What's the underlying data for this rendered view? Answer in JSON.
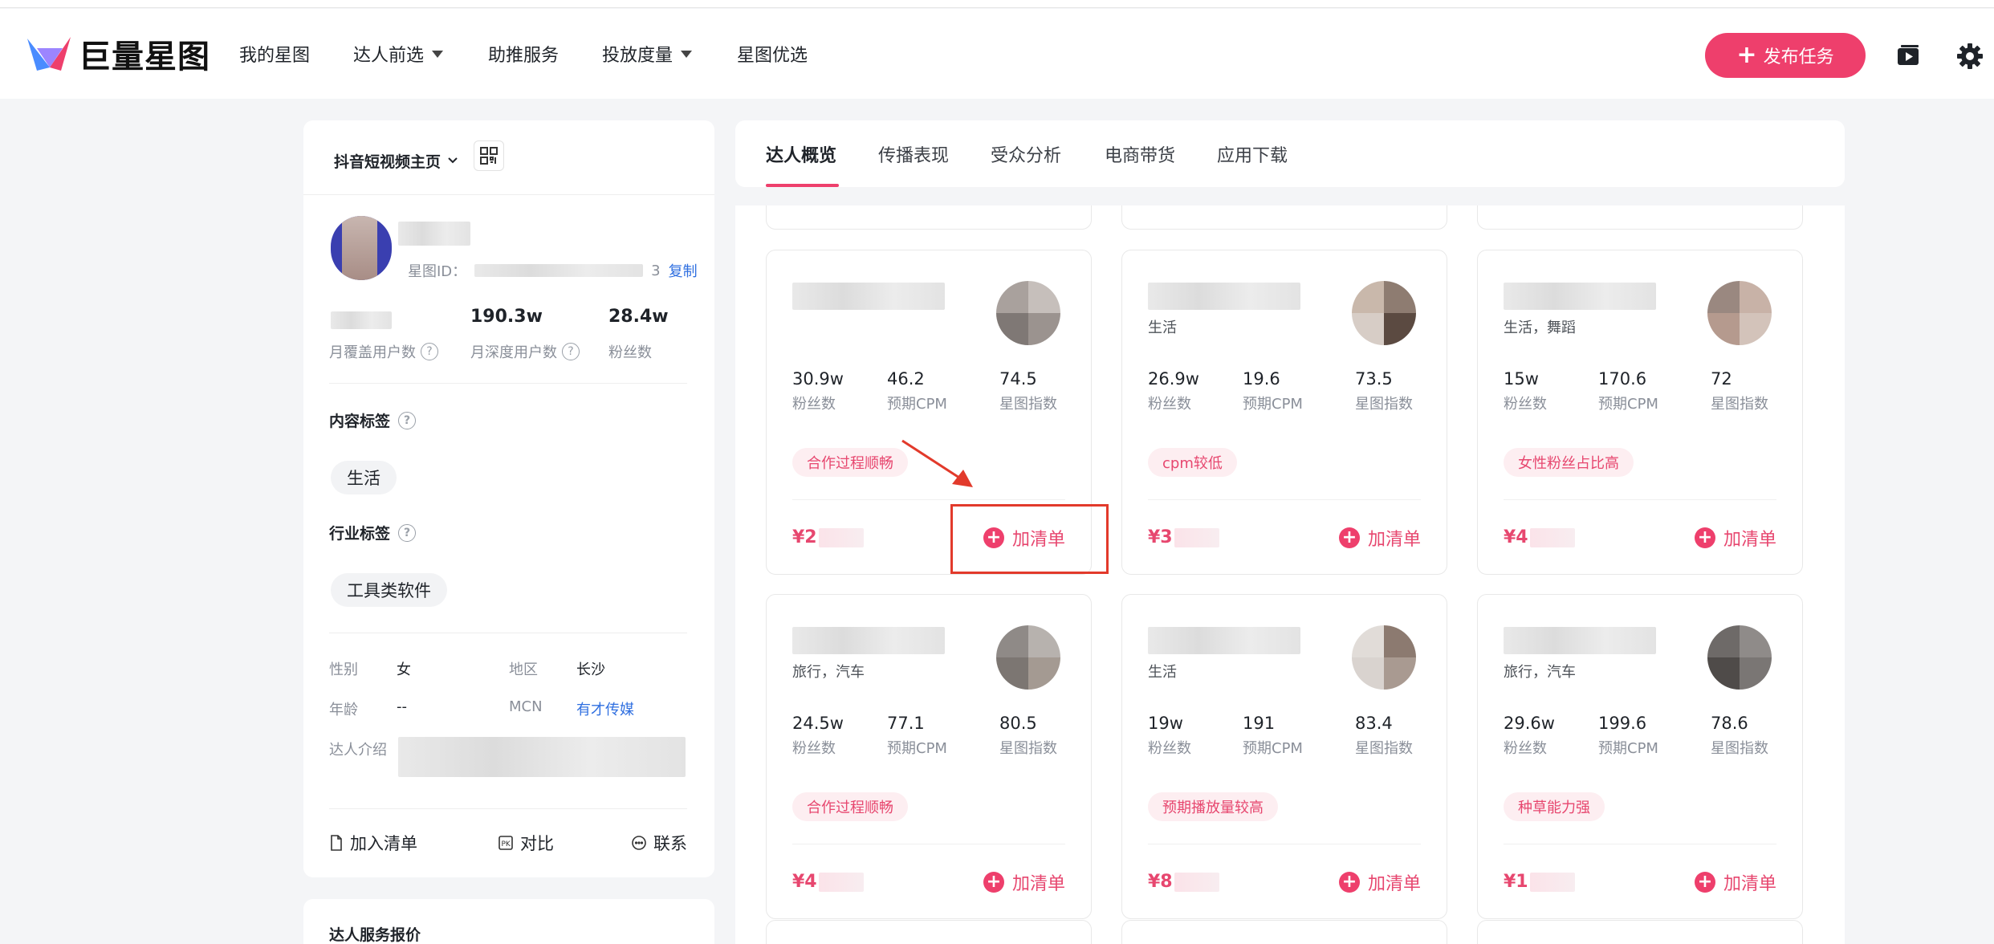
{
  "nav": {
    "logo_text": "巨量星图",
    "items": [
      "我的星图",
      "达人前选",
      "助推服务",
      "投放度量",
      "星图优选"
    ],
    "publish_label": "发布任务",
    "icons": [
      "video-icon",
      "gear-icon"
    ]
  },
  "profile": {
    "platform": "抖音短视频主页",
    "id_label": "星图ID：",
    "id_tail": "3",
    "copy_label": "复制",
    "stats": [
      {
        "value": "",
        "label": "月覆盖用户数"
      },
      {
        "value": "190.3w",
        "label": "月深度用户数"
      },
      {
        "value": "28.4w",
        "label": "粉丝数"
      }
    ],
    "content_tag_title": "内容标签",
    "content_tag": "生活",
    "industry_tag_title": "行业标签",
    "industry_tag": "工具类软件",
    "gender_label": "性别",
    "gender": "女",
    "region_label": "地区",
    "region": "长沙",
    "age_label": "年龄",
    "age": "--",
    "mcn_label": "MCN",
    "mcn": "有才传媒",
    "intro_label": "达人介绍",
    "actions": [
      "加入清单",
      "对比",
      "联系"
    ],
    "quote_title": "达人服务报价"
  },
  "tabs": [
    "达人概览",
    "传播表现",
    "受众分析",
    "电商带货",
    "应用下载"
  ],
  "stat_labels": [
    "粉丝数",
    "预期CPM",
    "星图指数"
  ],
  "add_label": "加清单",
  "cards": [
    {
      "tags": "",
      "fans": "30.9w",
      "cpm": "46.2",
      "index": "74.5",
      "badge": "合作过程顺畅",
      "price": "¥2"
    },
    {
      "tags": "生活",
      "fans": "26.9w",
      "cpm": "19.6",
      "index": "73.5",
      "badge": "cpm较低",
      "price": "¥3"
    },
    {
      "tags": "生活，舞蹈",
      "fans": "15w",
      "cpm": "170.6",
      "index": "72",
      "badge": "女性粉丝占比高",
      "price": "¥4"
    },
    {
      "tags": "旅行，汽车",
      "fans": "24.5w",
      "cpm": "77.1",
      "index": "80.5",
      "badge": "合作过程顺畅",
      "price": "¥4"
    },
    {
      "tags": "生活",
      "fans": "19w",
      "cpm": "191",
      "index": "83.4",
      "badge": "预期播放量较高",
      "price": "¥8"
    },
    {
      "tags": "旅行，汽车",
      "fans": "29.6w",
      "cpm": "199.6",
      "index": "78.6",
      "badge": "种草能力强",
      "price": "¥1"
    }
  ]
}
